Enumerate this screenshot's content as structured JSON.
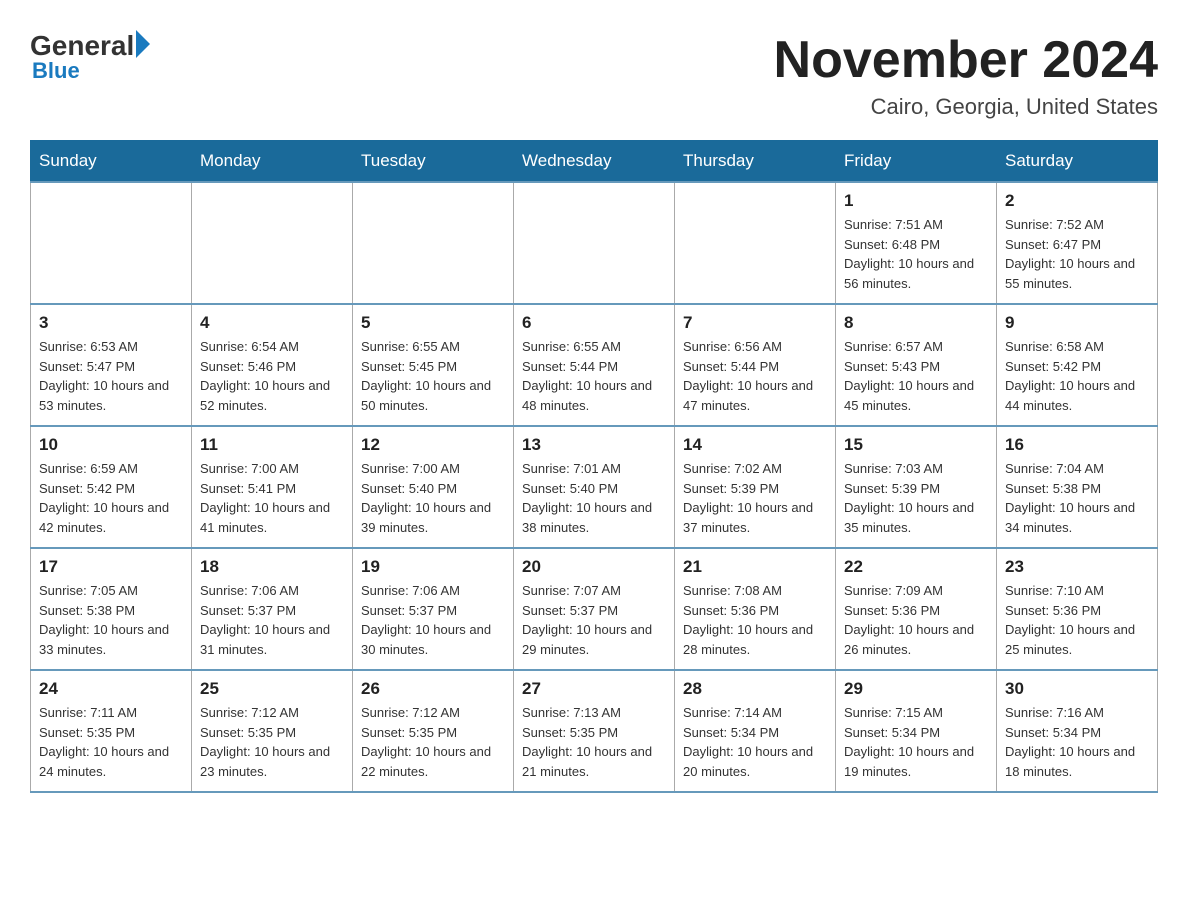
{
  "header": {
    "logo_general": "General",
    "logo_blue": "Blue",
    "month_title": "November 2024",
    "location": "Cairo, Georgia, United States"
  },
  "days_of_week": [
    "Sunday",
    "Monday",
    "Tuesday",
    "Wednesday",
    "Thursday",
    "Friday",
    "Saturday"
  ],
  "weeks": [
    [
      {
        "day": "",
        "sunrise": "",
        "sunset": "",
        "daylight": ""
      },
      {
        "day": "",
        "sunrise": "",
        "sunset": "",
        "daylight": ""
      },
      {
        "day": "",
        "sunrise": "",
        "sunset": "",
        "daylight": ""
      },
      {
        "day": "",
        "sunrise": "",
        "sunset": "",
        "daylight": ""
      },
      {
        "day": "",
        "sunrise": "",
        "sunset": "",
        "daylight": ""
      },
      {
        "day": "1",
        "sunrise": "Sunrise: 7:51 AM",
        "sunset": "Sunset: 6:48 PM",
        "daylight": "Daylight: 10 hours and 56 minutes."
      },
      {
        "day": "2",
        "sunrise": "Sunrise: 7:52 AM",
        "sunset": "Sunset: 6:47 PM",
        "daylight": "Daylight: 10 hours and 55 minutes."
      }
    ],
    [
      {
        "day": "3",
        "sunrise": "Sunrise: 6:53 AM",
        "sunset": "Sunset: 5:47 PM",
        "daylight": "Daylight: 10 hours and 53 minutes."
      },
      {
        "day": "4",
        "sunrise": "Sunrise: 6:54 AM",
        "sunset": "Sunset: 5:46 PM",
        "daylight": "Daylight: 10 hours and 52 minutes."
      },
      {
        "day": "5",
        "sunrise": "Sunrise: 6:55 AM",
        "sunset": "Sunset: 5:45 PM",
        "daylight": "Daylight: 10 hours and 50 minutes."
      },
      {
        "day": "6",
        "sunrise": "Sunrise: 6:55 AM",
        "sunset": "Sunset: 5:44 PM",
        "daylight": "Daylight: 10 hours and 48 minutes."
      },
      {
        "day": "7",
        "sunrise": "Sunrise: 6:56 AM",
        "sunset": "Sunset: 5:44 PM",
        "daylight": "Daylight: 10 hours and 47 minutes."
      },
      {
        "day": "8",
        "sunrise": "Sunrise: 6:57 AM",
        "sunset": "Sunset: 5:43 PM",
        "daylight": "Daylight: 10 hours and 45 minutes."
      },
      {
        "day": "9",
        "sunrise": "Sunrise: 6:58 AM",
        "sunset": "Sunset: 5:42 PM",
        "daylight": "Daylight: 10 hours and 44 minutes."
      }
    ],
    [
      {
        "day": "10",
        "sunrise": "Sunrise: 6:59 AM",
        "sunset": "Sunset: 5:42 PM",
        "daylight": "Daylight: 10 hours and 42 minutes."
      },
      {
        "day": "11",
        "sunrise": "Sunrise: 7:00 AM",
        "sunset": "Sunset: 5:41 PM",
        "daylight": "Daylight: 10 hours and 41 minutes."
      },
      {
        "day": "12",
        "sunrise": "Sunrise: 7:00 AM",
        "sunset": "Sunset: 5:40 PM",
        "daylight": "Daylight: 10 hours and 39 minutes."
      },
      {
        "day": "13",
        "sunrise": "Sunrise: 7:01 AM",
        "sunset": "Sunset: 5:40 PM",
        "daylight": "Daylight: 10 hours and 38 minutes."
      },
      {
        "day": "14",
        "sunrise": "Sunrise: 7:02 AM",
        "sunset": "Sunset: 5:39 PM",
        "daylight": "Daylight: 10 hours and 37 minutes."
      },
      {
        "day": "15",
        "sunrise": "Sunrise: 7:03 AM",
        "sunset": "Sunset: 5:39 PM",
        "daylight": "Daylight: 10 hours and 35 minutes."
      },
      {
        "day": "16",
        "sunrise": "Sunrise: 7:04 AM",
        "sunset": "Sunset: 5:38 PM",
        "daylight": "Daylight: 10 hours and 34 minutes."
      }
    ],
    [
      {
        "day": "17",
        "sunrise": "Sunrise: 7:05 AM",
        "sunset": "Sunset: 5:38 PM",
        "daylight": "Daylight: 10 hours and 33 minutes."
      },
      {
        "day": "18",
        "sunrise": "Sunrise: 7:06 AM",
        "sunset": "Sunset: 5:37 PM",
        "daylight": "Daylight: 10 hours and 31 minutes."
      },
      {
        "day": "19",
        "sunrise": "Sunrise: 7:06 AM",
        "sunset": "Sunset: 5:37 PM",
        "daylight": "Daylight: 10 hours and 30 minutes."
      },
      {
        "day": "20",
        "sunrise": "Sunrise: 7:07 AM",
        "sunset": "Sunset: 5:37 PM",
        "daylight": "Daylight: 10 hours and 29 minutes."
      },
      {
        "day": "21",
        "sunrise": "Sunrise: 7:08 AM",
        "sunset": "Sunset: 5:36 PM",
        "daylight": "Daylight: 10 hours and 28 minutes."
      },
      {
        "day": "22",
        "sunrise": "Sunrise: 7:09 AM",
        "sunset": "Sunset: 5:36 PM",
        "daylight": "Daylight: 10 hours and 26 minutes."
      },
      {
        "day": "23",
        "sunrise": "Sunrise: 7:10 AM",
        "sunset": "Sunset: 5:36 PM",
        "daylight": "Daylight: 10 hours and 25 minutes."
      }
    ],
    [
      {
        "day": "24",
        "sunrise": "Sunrise: 7:11 AM",
        "sunset": "Sunset: 5:35 PM",
        "daylight": "Daylight: 10 hours and 24 minutes."
      },
      {
        "day": "25",
        "sunrise": "Sunrise: 7:12 AM",
        "sunset": "Sunset: 5:35 PM",
        "daylight": "Daylight: 10 hours and 23 minutes."
      },
      {
        "day": "26",
        "sunrise": "Sunrise: 7:12 AM",
        "sunset": "Sunset: 5:35 PM",
        "daylight": "Daylight: 10 hours and 22 minutes."
      },
      {
        "day": "27",
        "sunrise": "Sunrise: 7:13 AM",
        "sunset": "Sunset: 5:35 PM",
        "daylight": "Daylight: 10 hours and 21 minutes."
      },
      {
        "day": "28",
        "sunrise": "Sunrise: 7:14 AM",
        "sunset": "Sunset: 5:34 PM",
        "daylight": "Daylight: 10 hours and 20 minutes."
      },
      {
        "day": "29",
        "sunrise": "Sunrise: 7:15 AM",
        "sunset": "Sunset: 5:34 PM",
        "daylight": "Daylight: 10 hours and 19 minutes."
      },
      {
        "day": "30",
        "sunrise": "Sunrise: 7:16 AM",
        "sunset": "Sunset: 5:34 PM",
        "daylight": "Daylight: 10 hours and 18 minutes."
      }
    ]
  ]
}
